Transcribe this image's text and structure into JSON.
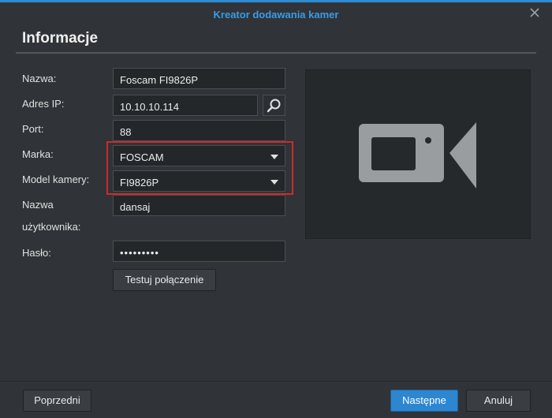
{
  "dialog": {
    "title": "Kreator dodawania kamer",
    "section_title": "Informacje"
  },
  "form": {
    "name": {
      "label": "Nazwa:",
      "value": "Foscam FI9826P"
    },
    "ip": {
      "label": "Adres IP:",
      "value": "10.10.10.114"
    },
    "port": {
      "label": "Port:",
      "value": "88"
    },
    "brand": {
      "label": "Marka:",
      "value": "FOSCAM"
    },
    "model": {
      "label": "Model kamery:",
      "value": "FI9826P"
    },
    "username": {
      "label_line1": "Nazwa",
      "label_line2": "użytkownika:",
      "value": "dansaj"
    },
    "password": {
      "label": "Hasło:",
      "value": "•••••••••"
    },
    "test_button": "Testuj połączenie"
  },
  "footer": {
    "prev_button": "Poprzedni",
    "next_button": "Następne",
    "cancel_button": "Anuluj"
  },
  "icons": {
    "close": "close-icon",
    "search": "search-icon",
    "camera": "video-camera-icon"
  },
  "colors": {
    "accent": "#2e8bd6",
    "highlight": "#cc2a2a"
  }
}
